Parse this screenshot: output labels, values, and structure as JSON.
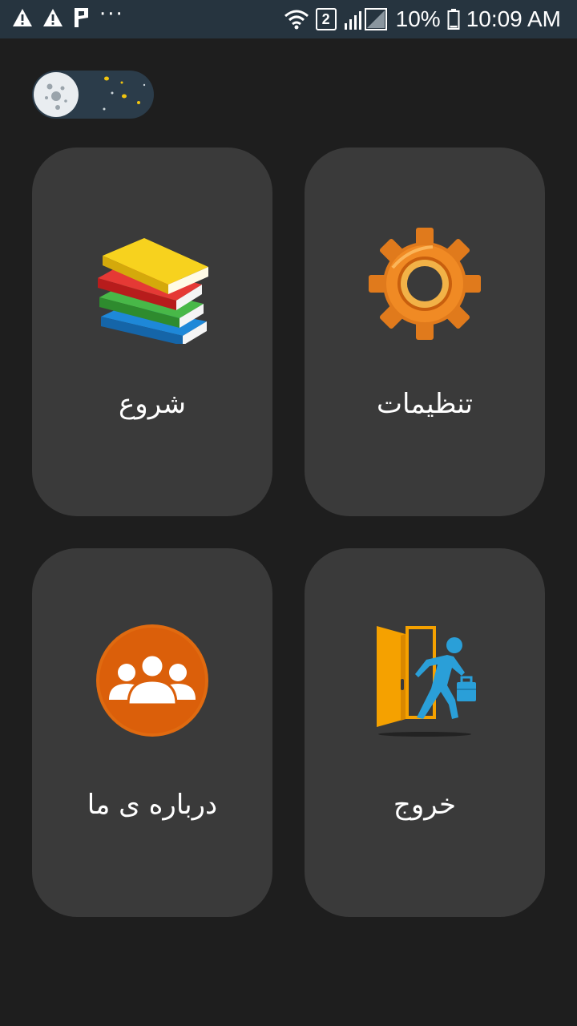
{
  "status_bar": {
    "battery_percent": "10%",
    "time": "10:09 AM",
    "sim_slot": "2",
    "icons": [
      "warning-icon",
      "warning-icon",
      "parking-icon",
      "more-icon",
      "wifi-icon",
      "signal-icon",
      "battery-icon"
    ]
  },
  "theme_toggle": {
    "state": "dark",
    "icons": [
      "moon-icon",
      "stars-icon"
    ]
  },
  "menu": {
    "start": {
      "label": "شروع",
      "icon": "books-icon"
    },
    "settings": {
      "label": "تنظیمات",
      "icon": "gear-icon"
    },
    "about": {
      "label": "درباره ی ما",
      "icon": "team-icon"
    },
    "exit": {
      "label": "خروج",
      "icon": "exit-door-icon"
    }
  },
  "colors": {
    "background": "#1e1e1e",
    "status_bar": "#26343f",
    "tile": "#3a3a3a",
    "accent_orange": "#e06a10",
    "accent_blue": "#2a9fd8"
  }
}
